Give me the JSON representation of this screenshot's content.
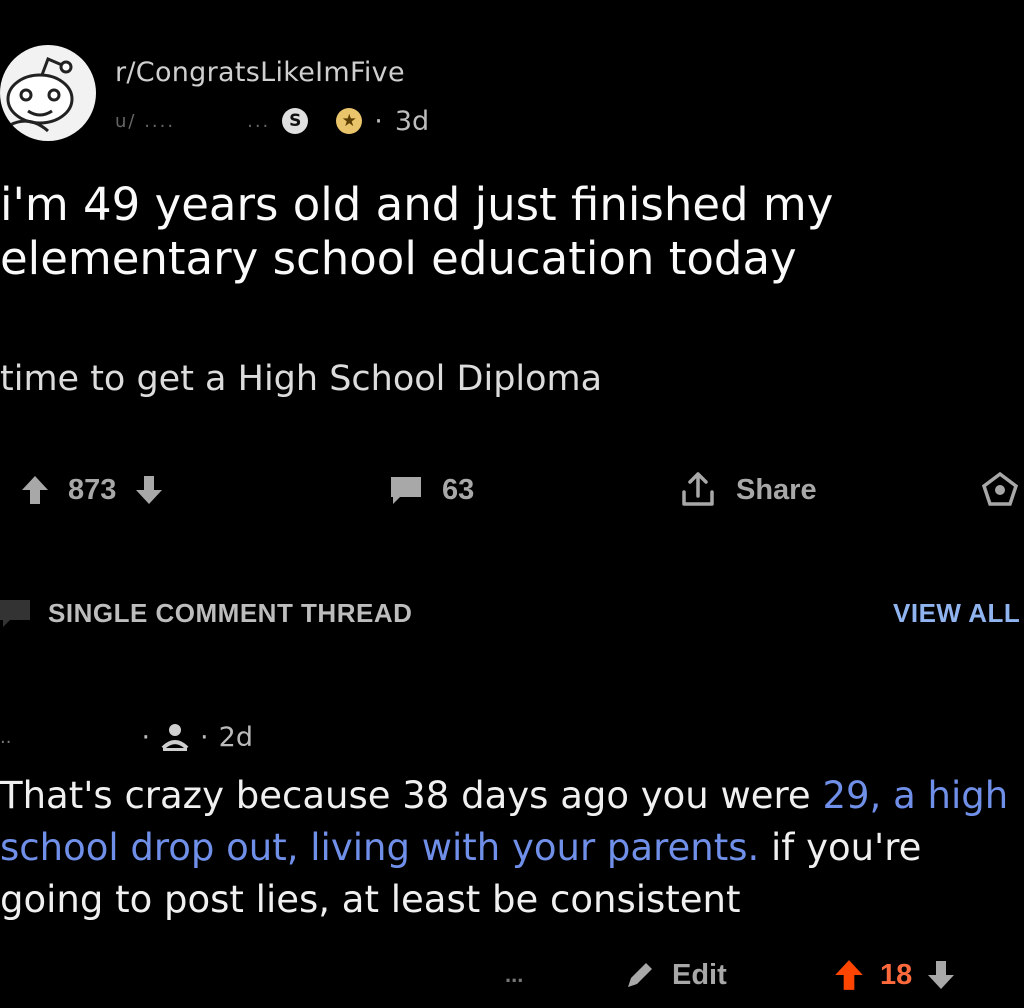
{
  "post": {
    "subreddit": "r/CongratsLikeImFive",
    "author_blurred": "u/ ....",
    "author_blurred_2": "...",
    "age": "3d",
    "dot": "·",
    "title": "i'm 49 years old and just finished my elementary school education today",
    "body": "time to get a High School Diploma",
    "upvotes": "873",
    "comments": "63",
    "share_label": "Share"
  },
  "thread": {
    "label": "SINGLE COMMENT THREAD",
    "view_all": "VIEW ALL"
  },
  "comment": {
    "age": "2d",
    "dot": "·",
    "user_blurred": "..",
    "text_plain_1": "That's crazy because 38 days ago you were ",
    "text_link": "29, a high school drop out, living with your parents.",
    "text_plain_2": " if you're going to post lies, at least be consistent",
    "more": "...",
    "edit_label": "Edit",
    "score": "18"
  },
  "colors": {
    "background": "#000000",
    "link_blue": "#6f8fe8",
    "upvote_orange": "#ff4500",
    "view_all_blue": "#8fb4f0"
  }
}
